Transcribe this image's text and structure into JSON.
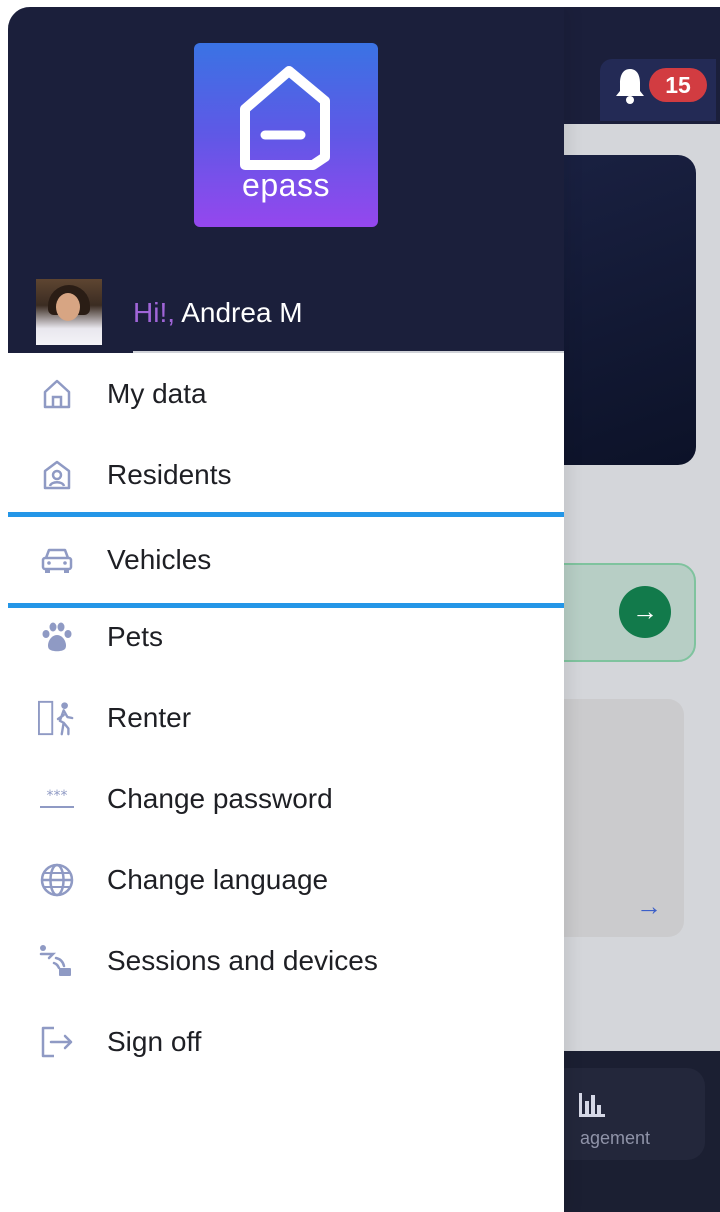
{
  "background": {
    "notification_count": "15",
    "nav_label": "agement"
  },
  "drawer": {
    "logo_text": "epass",
    "greeting_prefix": "Hi!,",
    "user_name": "Andrea M",
    "menu": [
      {
        "label": "My data",
        "icon": "home-icon"
      },
      {
        "label": "Residents",
        "icon": "resident-icon"
      },
      {
        "label": "Vehicles",
        "icon": "car-icon",
        "active": true
      },
      {
        "label": "Pets",
        "icon": "paw-icon"
      },
      {
        "label": "Renter",
        "icon": "renter-icon"
      },
      {
        "label": "Change password",
        "icon": "password-icon"
      },
      {
        "label": "Change language",
        "icon": "globe-icon"
      },
      {
        "label": "Sessions and devices",
        "icon": "devices-icon"
      },
      {
        "label": "Sign off",
        "icon": "sign-out-icon"
      }
    ]
  },
  "colors": {
    "header": "#1b1f3b",
    "active_border": "#2496e7",
    "greeting_accent": "#a065d8",
    "badge": "#d23c41",
    "icon": "#8f9ac4"
  }
}
